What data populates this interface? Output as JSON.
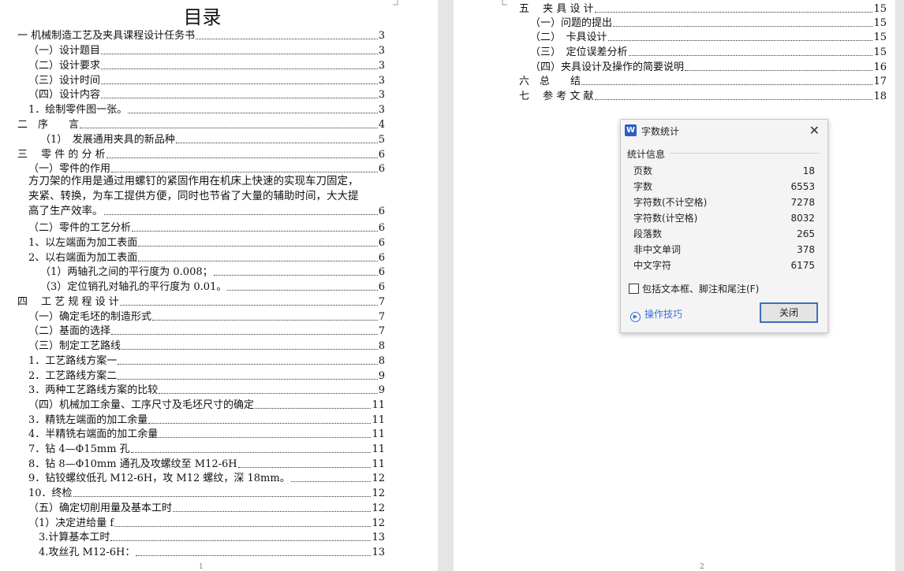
{
  "left_page": {
    "title": "目录",
    "entries": [
      {
        "text": "一 机械制造工艺及夹具课程设计任务书",
        "page": "3"
      },
      {
        "text": "（一）设计题目",
        "page": "3"
      },
      {
        "text": "（二）设计要求",
        "page": "3"
      },
      {
        "text": "（三）设计时间",
        "page": "3"
      },
      {
        "text": "（四）设计内容",
        "page": "3"
      },
      {
        "text": "1．绘制零件图一张。",
        "page": "3"
      },
      {
        "text": "二　序　　言",
        "page": "4"
      },
      {
        "text": "（1）　发展通用夹具的新品种",
        "page": "5"
      },
      {
        "text": "三　 零 件 的 分 析",
        "page": "6"
      },
      {
        "text": "（一）零件的作用",
        "page": "6"
      },
      {
        "text": "（二）零件的工艺分析",
        "page": "6"
      },
      {
        "text": "1、以左端面为加工表面",
        "page": "6"
      },
      {
        "text": "2、以右端面为加工表面",
        "page": "6"
      },
      {
        "text": "（1）两轴孔之间的平行度为 0.008；",
        "page": "6"
      },
      {
        "text": "（3）定位销孔对轴孔的平行度为 0.01。",
        "page": "6"
      },
      {
        "text": "四　 工 艺 规 程 设 计",
        "page": "7"
      },
      {
        "text": "（一）确定毛坯的制造形式",
        "page": "7"
      },
      {
        "text": "（二）基面的选择",
        "page": "7"
      },
      {
        "text": "（三）制定工艺路线",
        "page": "8"
      },
      {
        "text": "1．工艺路线方案一",
        "page": "8"
      },
      {
        "text": "2．工艺路线方案二",
        "page": "9"
      },
      {
        "text": "3．两种工艺路线方案的比较",
        "page": "9"
      },
      {
        "text": "（四）机械加工余量、工序尺寸及毛坯尺寸的确定",
        "page": "11"
      },
      {
        "text": "3．精铣左端面的加工余量",
        "page": "11"
      },
      {
        "text": "4．半精铣右端面的加工余量",
        "page": "11"
      },
      {
        "text": "7．钻 4—Φ15mm 孔",
        "page": "11"
      },
      {
        "text": "8．钻 8—Φ10mm 通孔及攻螺纹至 M12-6H",
        "page": "11"
      },
      {
        "text": "9．钻铰螺纹低孔 M12-6H，攻 M12 螺纹，深 18mm。",
        "page": "12"
      },
      {
        "text": "10．终检",
        "page": "12"
      },
      {
        "text": "（五）确定切削用量及基本工时",
        "page": "12"
      },
      {
        "text": "（1）决定进给量 f",
        "page": "12"
      },
      {
        "text": "3.计算基本工时",
        "page": "13"
      },
      {
        "text": "4.攻丝孔 M12-6H：",
        "page": "13"
      }
    ],
    "paragraph_lines": [
      "方刀架的作用是通过用螺钉的紧固作用在机床上快速的实现车刀固定，",
      "夹紧、转换，为车工提供方便，同时也节省了大量的辅助时间，大大提",
      "高了生产效率。"
    ],
    "paragraph_page": "6",
    "page_number": "1"
  },
  "right_page": {
    "entries": [
      {
        "text": "五　 夹 具 设 计",
        "page": "15"
      },
      {
        "text": "（一）问题的提出",
        "page": "15"
      },
      {
        "text": "（二）　卡具设计",
        "page": "15"
      },
      {
        "text": "（三）　定位误差分析",
        "page": "15"
      },
      {
        "text": "（四）夹具设计及操作的简要说明",
        "page": "16"
      },
      {
        "text": "六　总　　结",
        "page": "17"
      },
      {
        "text": "七　 参 考 文 献",
        "page": "18"
      }
    ],
    "page_number": "2"
  },
  "dialog": {
    "app_icon": "W",
    "title": "字数统计",
    "close_glyph": "✕",
    "group_label": "统计信息",
    "stats": [
      {
        "label": "页数",
        "value": "18"
      },
      {
        "label": "字数",
        "value": "6553"
      },
      {
        "label": "字符数(不计空格)",
        "value": "7278"
      },
      {
        "label": "字符数(计空格)",
        "value": "8032"
      },
      {
        "label": "段落数",
        "value": "265"
      },
      {
        "label": "非中文单词",
        "value": "378"
      },
      {
        "label": "中文字符",
        "value": "6175"
      }
    ],
    "checkbox_label": "包括文本框、脚注和尾注(F)",
    "checkbox_checked": false,
    "tips_label": "操作技巧",
    "close_button": "关闭"
  }
}
